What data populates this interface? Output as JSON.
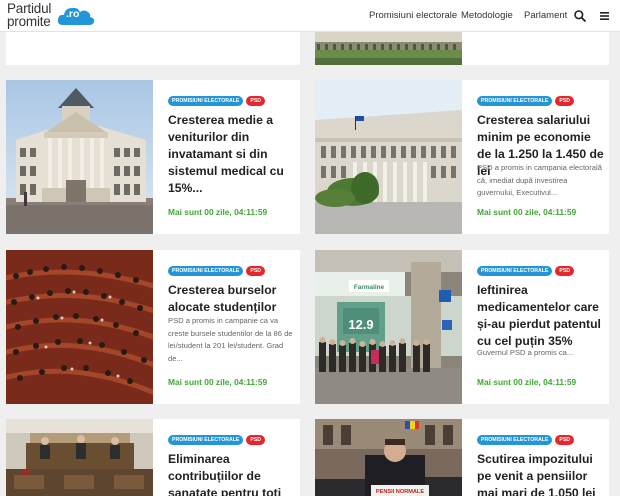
{
  "site": {
    "logo_line1": "Partidul",
    "logo_line2": "promite",
    "logo_ro": ".ro",
    "brand_color": "#2495d9"
  },
  "nav": {
    "items": [
      "Promisiuni electorale",
      "Metodologie",
      "Parlament"
    ],
    "search_icon": "search-icon",
    "menu_icon": "hamburger-menu-icon"
  },
  "colors": {
    "tag_category": "#2495d9",
    "tag_party": "#e5262d",
    "countdown": "#3fa833"
  },
  "cards": [
    {
      "tag1": "Promisiuni electorale",
      "tag2": "PSD",
      "title": "Cresterea medie a veniturilor din invatamant si din sistemul medical cu 15%...",
      "excerpt": "",
      "time": "Mai sunt 00 zile, 04:11:59"
    },
    {
      "tag1": "Promisiuni electorale",
      "tag2": "PSD",
      "title": "Cresterea salariului minim pe economie de la 1.250 la 1.450 de lei",
      "excerpt": "PSD a promis in campania electorală că, imediat după investirea guvernului, Executivul...",
      "time": "Mai sunt 00 zile, 04:11:59"
    },
    {
      "tag1": "Promisiuni electorale",
      "tag2": "PSD",
      "title": "Cresterea burselor alocate studenților",
      "excerpt": "PSD a promis in campanie ca va creste bursele studentilor de la 86 de lei/student la 201 lei/student. Grad de...",
      "time": "Mai sunt 00 zile, 04:11:59"
    },
    {
      "tag1": "Promisiuni electorale",
      "tag2": "PSD",
      "title": "Ieftinirea medicamentelor care și-au pierdut patentul cu cel puțin 35%",
      "excerpt": "Guvernul PSD a promis ca...",
      "time": "Mai sunt 00 zile, 04:11:59"
    },
    {
      "tag1": "Promisiuni electorale",
      "tag2": "PSD",
      "title": "Eliminarea contribuțiilor de sanatate pentru toti",
      "excerpt": "",
      "time": ""
    },
    {
      "tag1": "Promisiuni electorale",
      "tag2": "PSD",
      "title": "Scutirea impozitului pe venit a pensiilor mai mari de 1.050 lei",
      "excerpt": "",
      "time": ""
    }
  ],
  "photo_signs": {
    "pharmacy_name": "Farmaline",
    "pharmacy_price": "12.9",
    "banner": "PENSII NORMALE"
  }
}
